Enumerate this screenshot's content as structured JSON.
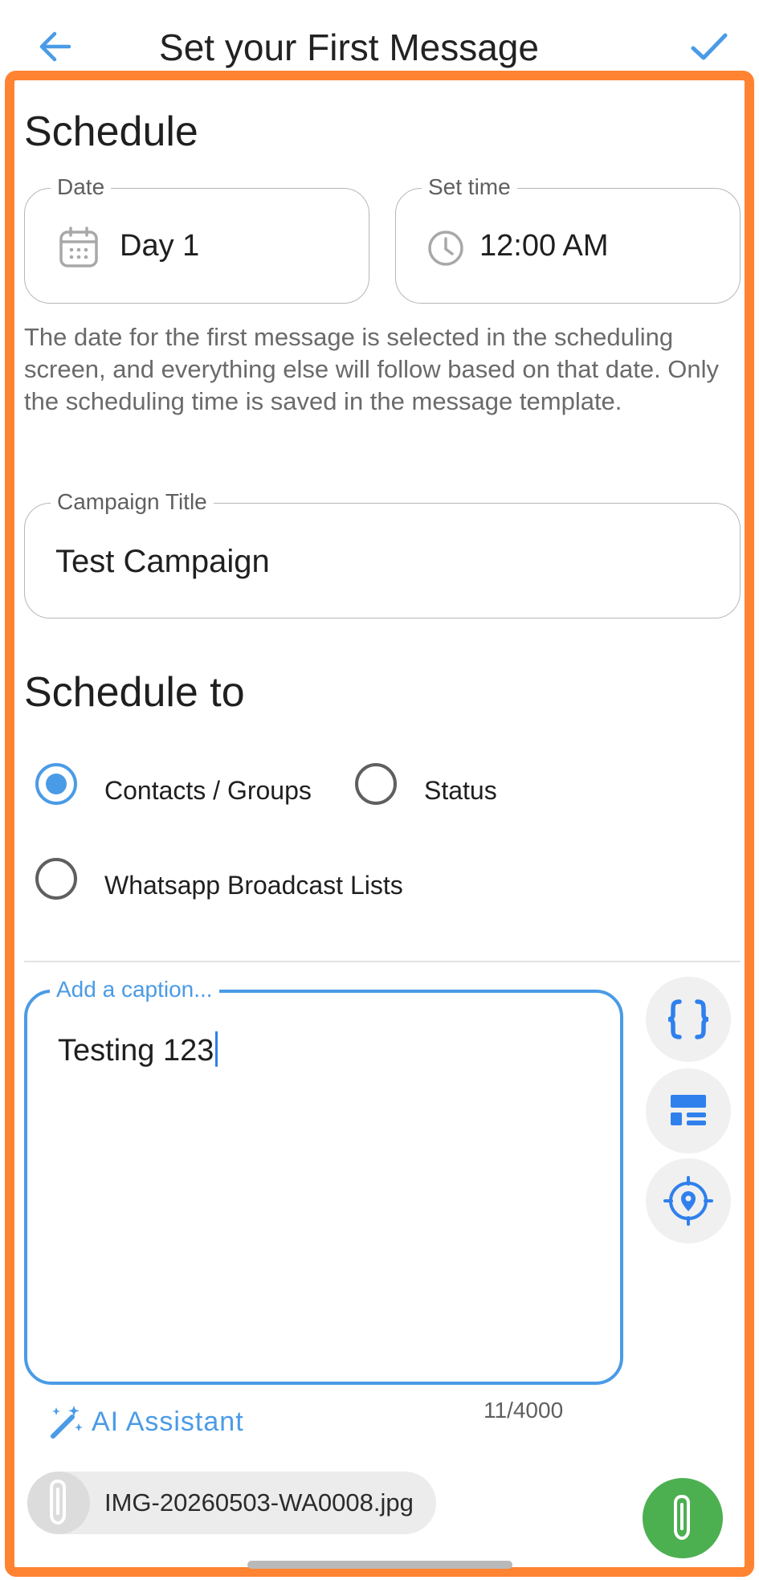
{
  "header": {
    "title": "Set your First Message",
    "back_icon": "arrow-left-icon",
    "confirm_icon": "checkmark-icon"
  },
  "schedule": {
    "heading": "Schedule",
    "date_label": "Date",
    "date_value": "Day 1",
    "time_label": "Set time",
    "time_value": "12:00 AM",
    "helper": "The date for the first message is selected in the scheduling screen, and everything else will follow based on that date. Only the scheduling time is saved in the message template."
  },
  "campaign": {
    "label": "Campaign Title",
    "value": "Test Campaign"
  },
  "schedule_to": {
    "heading": "Schedule to",
    "options": [
      {
        "label": "Contacts / Groups",
        "selected": true
      },
      {
        "label": "Status",
        "selected": false
      },
      {
        "label": "Whatsapp Broadcast Lists",
        "selected": false
      }
    ]
  },
  "caption": {
    "label": "Add a caption...",
    "value": "Testing 123",
    "counter": "11/4000"
  },
  "ai": {
    "label": "AI Assistant"
  },
  "attachment": {
    "filename": "IMG-20260503-WA0008.jpg"
  },
  "colors": {
    "accent": "#4a9be6",
    "frame": "#ff8331",
    "fab": "#4caf50"
  }
}
